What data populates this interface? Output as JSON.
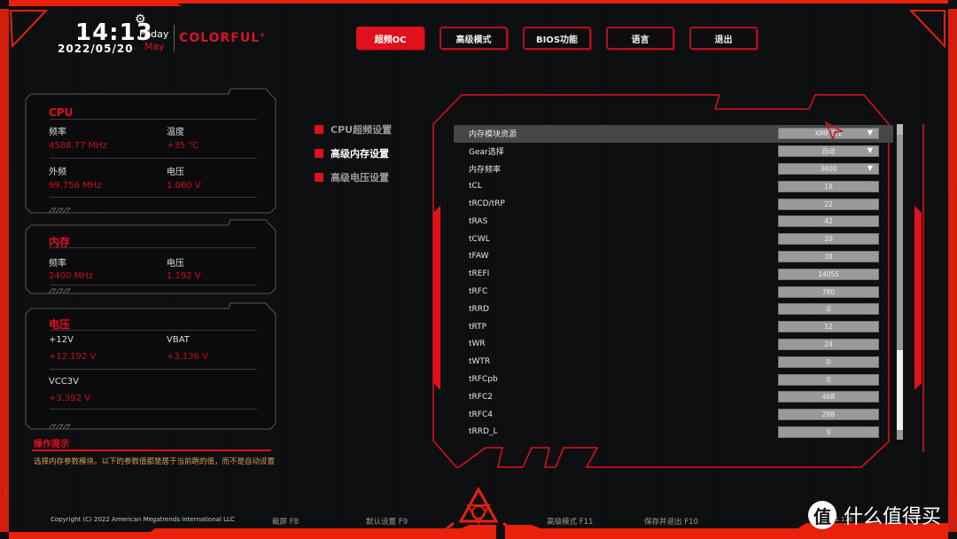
{
  "header": {
    "time": "14:13",
    "date": "2022/05/20",
    "weekday": "Friday",
    "month": "May",
    "brand": "COLORFUL",
    "brand_mark": "®",
    "settings_icon": "gear-icon"
  },
  "colors": {
    "accent": "#e0101c",
    "panel_value": "#c8101c",
    "tip_text": "#d8a050",
    "field_bg": "#9a9a9a"
  },
  "nav": [
    {
      "label": "超频OC",
      "active": true
    },
    {
      "label": "高级模式",
      "active": false
    },
    {
      "label": "BIOS功能",
      "active": false
    },
    {
      "label": "语言",
      "active": false
    },
    {
      "label": "退出",
      "active": false
    }
  ],
  "panels": {
    "cpu": {
      "title": "CPU",
      "items": [
        {
          "label": "频率",
          "value": "4588.77 MHz"
        },
        {
          "label": "温度",
          "value": "+35 °C"
        },
        {
          "label": "外频",
          "value": "99.756 MHz"
        },
        {
          "label": "电压",
          "value": "1.060 V"
        }
      ]
    },
    "memory": {
      "title": "内存",
      "items": [
        {
          "label": "频率",
          "value": "2400 MHz"
        },
        {
          "label": "电压",
          "value": "1.192 V"
        }
      ]
    },
    "voltage": {
      "title": "电压",
      "items": [
        {
          "label": "+12V",
          "value": "+12.192 V"
        },
        {
          "label": "VBAT",
          "value": "+3.136 V"
        },
        {
          "label": "VCC3V",
          "value": "+3.392 V"
        }
      ]
    }
  },
  "submenu": [
    {
      "label": "CPU超频设置",
      "active": false
    },
    {
      "label": "高级内存设置",
      "active": true
    },
    {
      "label": "高级电压设置",
      "active": false
    }
  ],
  "settings": [
    {
      "name": "内存模块资源",
      "value": "XMP 1.1",
      "dropdown": true,
      "selected": true
    },
    {
      "name": "Gear选择",
      "value": "自动",
      "dropdown": true
    },
    {
      "name": "内存频率",
      "value": "3600",
      "dropdown": true
    },
    {
      "name": "tCL",
      "value": "18"
    },
    {
      "name": "tRCD/tRP",
      "value": "22"
    },
    {
      "name": "tRAS",
      "value": "42"
    },
    {
      "name": "tCWL",
      "value": "20"
    },
    {
      "name": "tFAW",
      "value": "38"
    },
    {
      "name": "tREFI",
      "value": "14055"
    },
    {
      "name": "tRFC",
      "value": "780"
    },
    {
      "name": "tRRD",
      "value": "0"
    },
    {
      "name": "tRTP",
      "value": "12"
    },
    {
      "name": "tWR",
      "value": "24"
    },
    {
      "name": "tWTR",
      "value": "0"
    },
    {
      "name": "tRFCpb",
      "value": "0"
    },
    {
      "name": "tRFC2",
      "value": "468"
    },
    {
      "name": "tRFC4",
      "value": "288"
    },
    {
      "name": "tRRD_L",
      "value": "9"
    }
  ],
  "tip": {
    "title": "操作提示",
    "text": "选择内存参数模块。以下的参数值都是居于当前跑的值，而不是自动设置"
  },
  "footer": {
    "copyright": "Copyright (C) 2022 American Megatrends International LLC",
    "keys": [
      {
        "label": "截屏 F8"
      },
      {
        "label": "默认设置 F9"
      },
      {
        "label": "高级模式 F11"
      },
      {
        "label": "保存并退出 F10"
      }
    ],
    "version": "Version: 1.126"
  },
  "watermark": {
    "badge": "值",
    "text": "什么值得买"
  }
}
